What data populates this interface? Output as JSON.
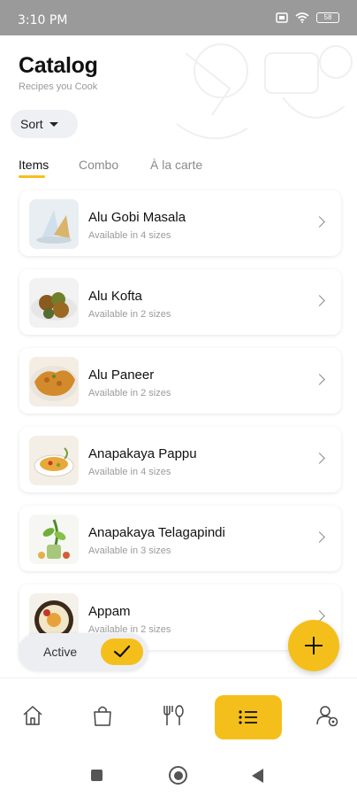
{
  "status": {
    "time": "3:10 PM",
    "battery": "58"
  },
  "header": {
    "title": "Catalog",
    "subtitle": "Recipes you Cook"
  },
  "sort": {
    "label": "Sort"
  },
  "tabs": [
    {
      "label": "Items",
      "active": true
    },
    {
      "label": "Combo",
      "active": false
    },
    {
      "label": "À la carte",
      "active": false
    }
  ],
  "items": [
    {
      "name": "Alu Gobi Masala",
      "sizes": "Available in 4 sizes"
    },
    {
      "name": "Alu Kofta",
      "sizes": "Available in 2 sizes"
    },
    {
      "name": "Alu Paneer",
      "sizes": "Available in 2 sizes"
    },
    {
      "name": "Anapakaya Pappu",
      "sizes": "Available in 4 sizes"
    },
    {
      "name": "Anapakaya Telagapindi",
      "sizes": "Available in 3 sizes"
    },
    {
      "name": "Appam",
      "sizes": "Available in 2 sizes"
    }
  ],
  "active_filter": {
    "label": "Active",
    "checked": true
  },
  "colors": {
    "accent": "#f5bf1b",
    "status_bar": "#9a9a9a",
    "card_shadow": "#e6e6e6"
  },
  "bottom_nav": [
    {
      "icon": "home-icon",
      "active": false
    },
    {
      "icon": "shopping-bag-icon",
      "active": false
    },
    {
      "icon": "fork-spoon-icon",
      "active": false
    },
    {
      "icon": "list-icon",
      "active": true
    },
    {
      "icon": "user-settings-icon",
      "active": false
    }
  ]
}
